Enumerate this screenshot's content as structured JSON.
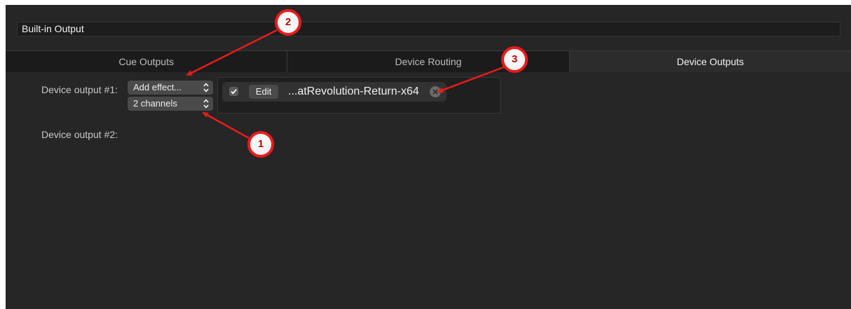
{
  "window": {
    "output_name": "Built-in Output"
  },
  "tabs": [
    {
      "label": "Cue Outputs",
      "active": false
    },
    {
      "label": "Device Routing",
      "active": false
    },
    {
      "label": "Device Outputs",
      "active": true
    }
  ],
  "device_outputs": [
    {
      "label": "Device output #1:",
      "add_effect": "Add effect...",
      "channels": "2 channels",
      "effects": [
        {
          "enabled": true,
          "edit_label": "Edit",
          "name": "...atRevolution-Return-x64"
        }
      ]
    },
    {
      "label": "Device output #2:"
    }
  ],
  "annotations": [
    {
      "number": "1",
      "color": "#c00000"
    },
    {
      "number": "2",
      "color": "#c00000"
    },
    {
      "number": "3",
      "color": "#c00000"
    }
  ],
  "colors": {
    "panel": "#262626",
    "tab_inactive": "#1b1b1b",
    "tab_active": "#2c2c2c",
    "annotation": "#e81c1c"
  }
}
